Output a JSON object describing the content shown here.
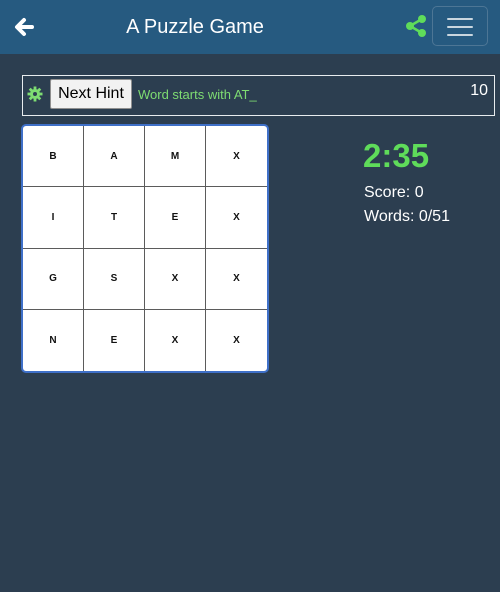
{
  "header": {
    "title": "A Puzzle Game",
    "back_icon": "arrow-left-icon",
    "share_icon": "share-icon",
    "menu_icon": "hamburger-menu-icon",
    "accent_color": "#265a80",
    "share_color": "#5fdc5a"
  },
  "hint_bar": {
    "settings_icon": "gear-icon",
    "next_hint_label": "Next Hint",
    "hint_text": "Word starts with AT_",
    "hint_count": "10",
    "hint_color": "#7edc72"
  },
  "board": {
    "rows": [
      [
        "B",
        "A",
        "M",
        "X"
      ],
      [
        "I",
        "T",
        "E",
        "X"
      ],
      [
        "G",
        "S",
        "X",
        "X"
      ],
      [
        "N",
        "E",
        "X",
        "X"
      ]
    ],
    "border_color": "#3f70c8"
  },
  "stats": {
    "timer": "2:35",
    "score": "Score: 0",
    "words": "Words: 0/51",
    "timer_color": "#5fdc5a"
  }
}
